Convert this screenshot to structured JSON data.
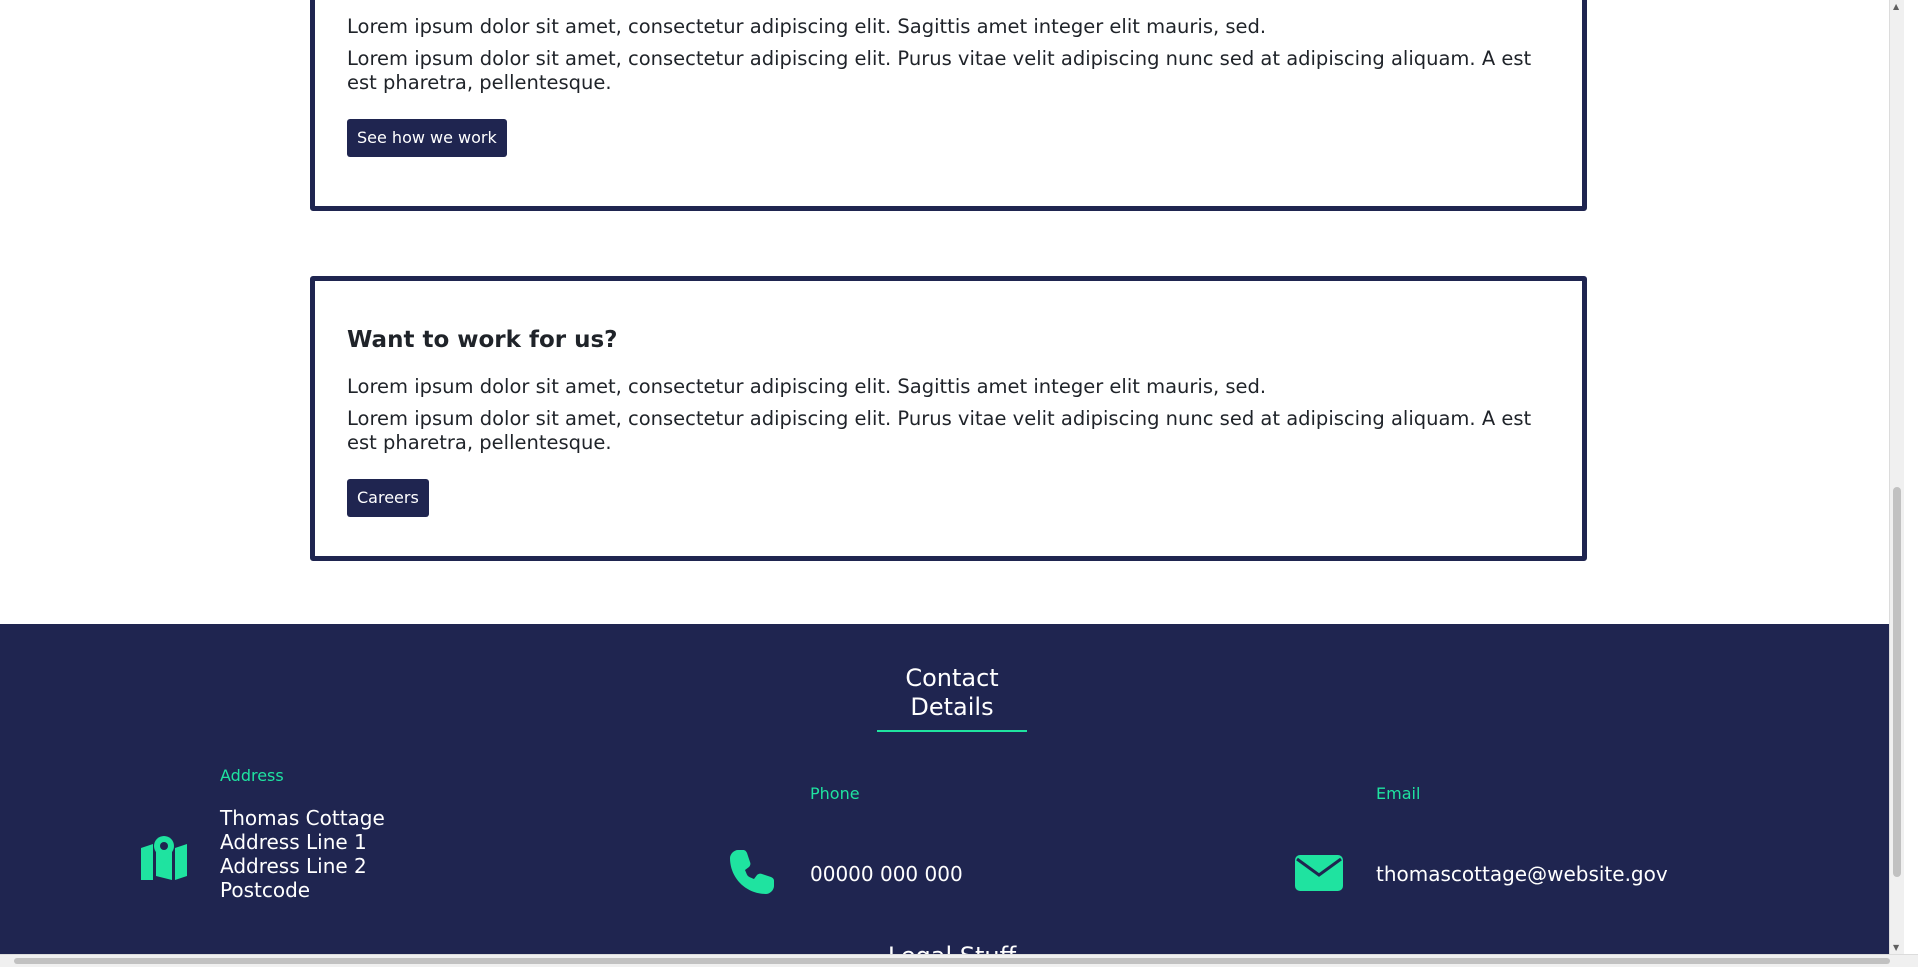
{
  "cards": [
    {
      "title": "",
      "paragraph_1": "Lorem ipsum dolor sit amet, consectetur adipiscing elit. Sagittis amet integer elit mauris, sed.",
      "paragraph_2": "Lorem ipsum dolor sit amet, consectetur adipiscing elit. Purus vitae velit adipiscing nunc sed at adipiscing aliquam. A est est pharetra, pellentesque.",
      "button_label": "See how we work"
    },
    {
      "title": "Want to work for us?",
      "paragraph_1": "Lorem ipsum dolor sit amet, consectetur adipiscing elit. Sagittis amet integer elit mauris, sed.",
      "paragraph_2": "Lorem ipsum dolor sit amet, consectetur adipiscing elit. Purus vitae velit adipiscing nunc sed at adipiscing aliquam. A est est pharetra, pellentesque.",
      "button_label": "Careers"
    }
  ],
  "footer": {
    "heading_line_1": "Contact",
    "heading_line_2": "Details",
    "address": {
      "label": "Address",
      "line_1": "Thomas Cottage",
      "line_2": "Address Line 1",
      "line_3": "Address Line 2",
      "line_4": "Postcode",
      "icon": "map-pin-icon"
    },
    "phone": {
      "label": "Phone",
      "value": "00000 000 000",
      "icon": "phone-icon"
    },
    "email": {
      "label": "Email",
      "value": "thomascottage@website.gov",
      "icon": "envelope-icon"
    },
    "legal_heading": "Legal Stuff"
  },
  "colors": {
    "navy": "#1f2550",
    "accent_green": "#1fe3a0",
    "text_dark": "#1f2329",
    "white": "#ffffff"
  }
}
